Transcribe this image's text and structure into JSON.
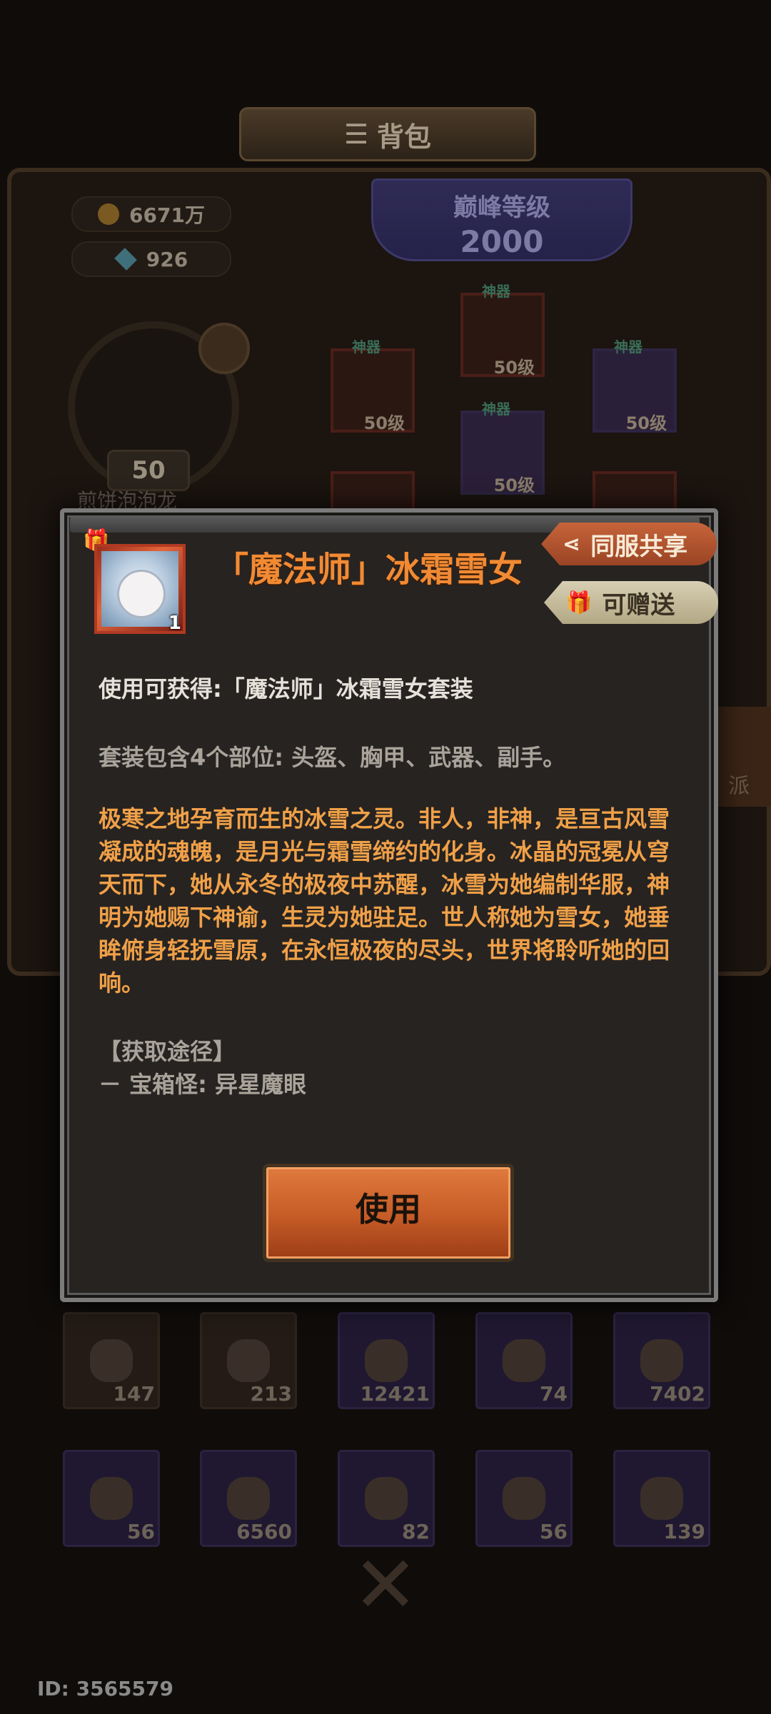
{
  "background": {
    "title": "背包",
    "gold": "6671万",
    "gems": "926",
    "peak_level_title": "巅峰等级",
    "peak_level_value": "2000",
    "avatar_level": "50",
    "avatar_name": "煎饼泡泡龙",
    "equip_tag": "神器",
    "equip_levels": [
      "50级",
      "50级",
      "50级",
      "50级"
    ],
    "side_tab_label": "派",
    "inventory_row1": [
      "147",
      "213",
      "12421",
      "74",
      "7402"
    ],
    "inventory_row2": [
      "56",
      "6560",
      "82",
      "56",
      "139"
    ],
    "user_id": "ID: 3565579"
  },
  "modal": {
    "item_title": "「魔法师」冰霜雪女",
    "item_quantity": "1",
    "share_label": "同服共享",
    "gift_label": "可赠送",
    "use_result": "使用可获得:「魔法师」冰霜雪女套装",
    "set_parts": "套装包含4个部位: 头盔、胸甲、武器、副手。",
    "lore": "极寒之地孕育而生的冰雪之灵。非人，非神，是亘古风雪凝成的魂魄，是月光与霜雪缔约的化身。冰晶的冠冕从穹天而下，她从永冬的极夜中苏醒，冰雪为她编制华服，神明为她赐下神谕，生灵为她驻足。世人称她为雪女，她垂眸俯身轻抚雪原，在永恒极夜的尽头，世界将聆听她的回响。",
    "source_header": "【获取途径】",
    "source_item": "－ 宝箱怪: 异星魔眼",
    "use_button": "使用"
  },
  "colors": {
    "title_orange": "#f28a33",
    "lore_gold": "#f0a048",
    "button_orange": "#c55b26"
  }
}
